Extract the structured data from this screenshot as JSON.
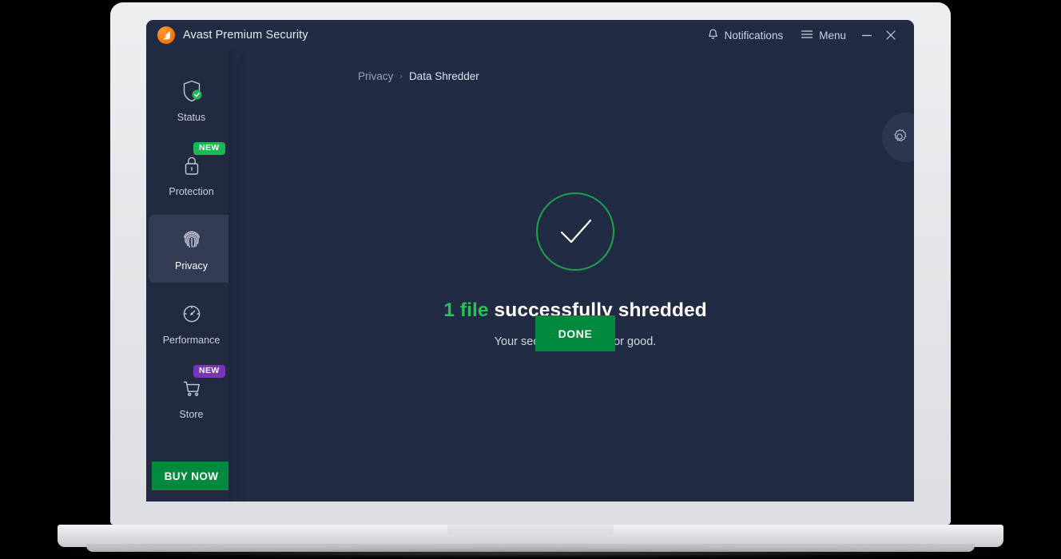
{
  "window": {
    "title": "Avast Premium Security",
    "logo_icon": "avast-logo-icon",
    "notifications_label": "Notifications",
    "notifications_icon": "bell-icon",
    "menu_label": "Menu",
    "menu_icon": "hamburger-icon",
    "minimize_icon": "minimize-icon",
    "close_icon": "close-icon"
  },
  "sidebar": {
    "items": [
      {
        "id": "status",
        "label": "Status",
        "icon": "shield-check-icon",
        "badge": null,
        "active": false
      },
      {
        "id": "protection",
        "label": "Protection",
        "icon": "lock-icon",
        "badge": "NEW",
        "badge_color": "#1ab955",
        "active": false
      },
      {
        "id": "privacy",
        "label": "Privacy",
        "icon": "fingerprint-icon",
        "badge": null,
        "active": true
      },
      {
        "id": "performance",
        "label": "Performance",
        "icon": "speedometer-icon",
        "badge": null,
        "active": false
      },
      {
        "id": "store",
        "label": "Store",
        "icon": "shopping-cart-icon",
        "badge": "NEW",
        "badge_color": "#7b35bd",
        "active": false
      }
    ],
    "buy_now_label": "BUY NOW"
  },
  "breadcrumb": {
    "parent": "Privacy",
    "separator": "›",
    "current": "Data Shredder"
  },
  "content": {
    "settings_icon": "gear-icon",
    "status_icon": "check-circle-icon",
    "result_count": "1 file",
    "result_title_rest": "successfully shredded",
    "result_subtitle": "Your secrets are gone for good.",
    "done_label": "DONE"
  },
  "colors": {
    "window_bg": "#222b44",
    "sidebar_bg": "#222a42",
    "active_tile": "#333c54",
    "accent_green": "#01893e",
    "success_green": "#27c257",
    "badge_green": "#1ab955",
    "badge_purple": "#7b35bd",
    "brand_orange": "#f97a08"
  }
}
